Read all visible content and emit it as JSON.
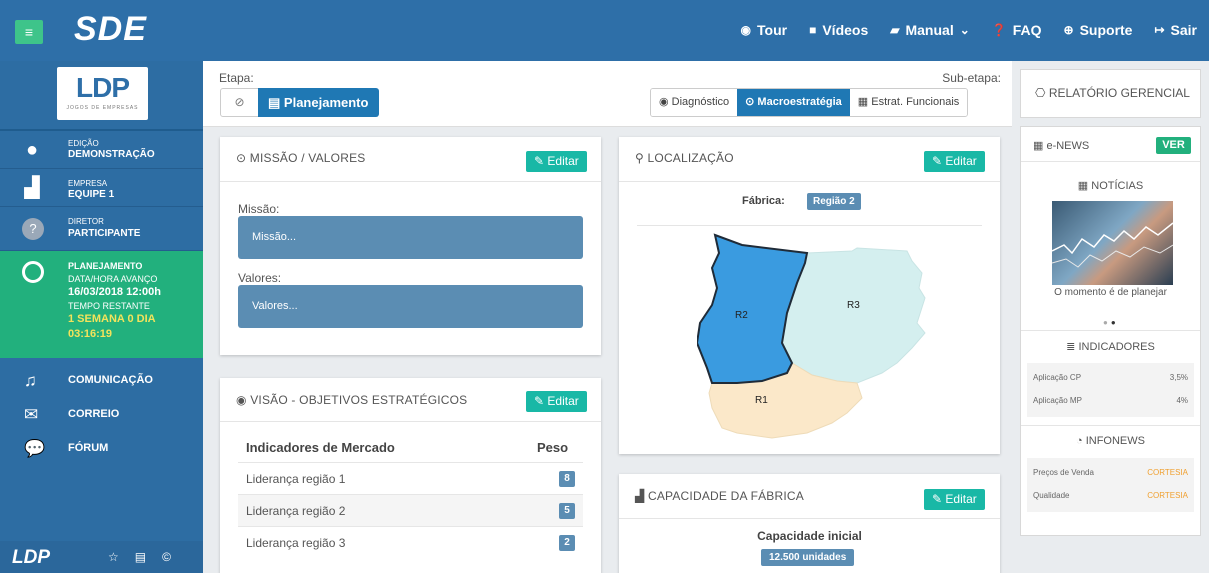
{
  "topbar": {
    "brand": "SDE",
    "nav": [
      {
        "icon": "compass-icon",
        "label": "Tour"
      },
      {
        "icon": "video-camera-icon",
        "label": "Vídeos"
      },
      {
        "icon": "book-icon",
        "label": "Manual"
      },
      {
        "icon": "question-circle-icon",
        "label": "FAQ"
      },
      {
        "icon": "lifebuoy-icon",
        "label": "Suporte"
      },
      {
        "icon": "sign-out-icon",
        "label": "Sair"
      }
    ]
  },
  "sidebar": {
    "logo": {
      "text": "LDP",
      "subtitle": "JOGOS DE EMPRESAS"
    },
    "info": [
      {
        "label": "EDIÇÃO",
        "value": "DEMONSTRAÇÃO"
      },
      {
        "label": "EMPRESA",
        "value": "EQUIPE 1"
      },
      {
        "label": "DIRETOR",
        "value": "PARTICIPANTE"
      }
    ],
    "planning": {
      "title": "PLANEJAMENTO",
      "advance_label": "DATA/HORA AVANÇO",
      "advance_value": "16/03/2018 12:00h",
      "remaining_label": "TEMPO RESTANTE",
      "remaining_days": "1 semana 0 dia",
      "remaining_time": "03:16:19"
    },
    "links": [
      {
        "icon": "bell-icon",
        "label": "COMUNICAÇÃO"
      },
      {
        "icon": "envelope-icon",
        "label": "CORREIO"
      },
      {
        "icon": "comments-icon",
        "label": "FÓRUM"
      }
    ],
    "footer_logo": "LDP"
  },
  "etapa": {
    "label": "Etapa:",
    "active": "Planejamento",
    "sub_label": "Sub-etapa:",
    "sub_tabs": [
      {
        "label": "Diagnóstico",
        "active": false
      },
      {
        "label": "Macroestratégia",
        "active": true
      },
      {
        "label": "Estrat. Funcionais",
        "active": false
      }
    ]
  },
  "missao": {
    "title": "MISSÃO / VALORES",
    "edit": "Editar",
    "missao_label": "Missão:",
    "missao_value": "Missão...",
    "valores_label": "Valores:",
    "valores_value": "Valores..."
  },
  "visao": {
    "title": "VISÃO - OBJETIVOS ESTRATÉGICOS",
    "edit": "Editar",
    "col_name": "Indicadores de Mercado",
    "col_weight": "Peso",
    "rows": [
      {
        "name": "Liderança região 1",
        "weight": "8"
      },
      {
        "name": "Liderança região 2",
        "weight": "5"
      },
      {
        "name": "Liderança região 3",
        "weight": "2"
      }
    ]
  },
  "localizacao": {
    "title": "LOCALIZAÇÃO",
    "edit": "Editar",
    "fabrica_label": "Fábrica:",
    "fabrica_value": "Região 2",
    "regions": [
      {
        "name": "R1",
        "color": "#fbe8c9"
      },
      {
        "name": "R2",
        "color": "#3a9be0"
      },
      {
        "name": "R3",
        "color": "#d4efef"
      }
    ]
  },
  "capacidade": {
    "title": "CAPACIDADE DA FÁBRICA",
    "edit": "Editar",
    "label": "Capacidade inicial",
    "value": "12.500 unidades"
  },
  "right": {
    "relatorio": "RELATÓRIO GERENCIAL",
    "enews": "e-NEWS",
    "ver": "VER",
    "noticias": "NOTÍCIAS",
    "news_caption": "O momento é de planejar",
    "indicadores_title": "INDICADORES",
    "indicadores": [
      {
        "name": "Aplicação CP",
        "value": "3,5%"
      },
      {
        "name": "Aplicação MP",
        "value": "4%"
      }
    ],
    "infonews_title": "INFONEWS",
    "infonews": [
      {
        "name": "Preços de Venda",
        "value": "CORTESIA"
      },
      {
        "name": "Qualidade",
        "value": "CORTESIA"
      }
    ]
  },
  "colors": {
    "topbar": "#2e6fa8",
    "sidebar": "#2d6da3",
    "planning": "#22b07d",
    "accent": "#1f78b4",
    "edit": "#19b8a6",
    "field": "#5b8db3"
  }
}
